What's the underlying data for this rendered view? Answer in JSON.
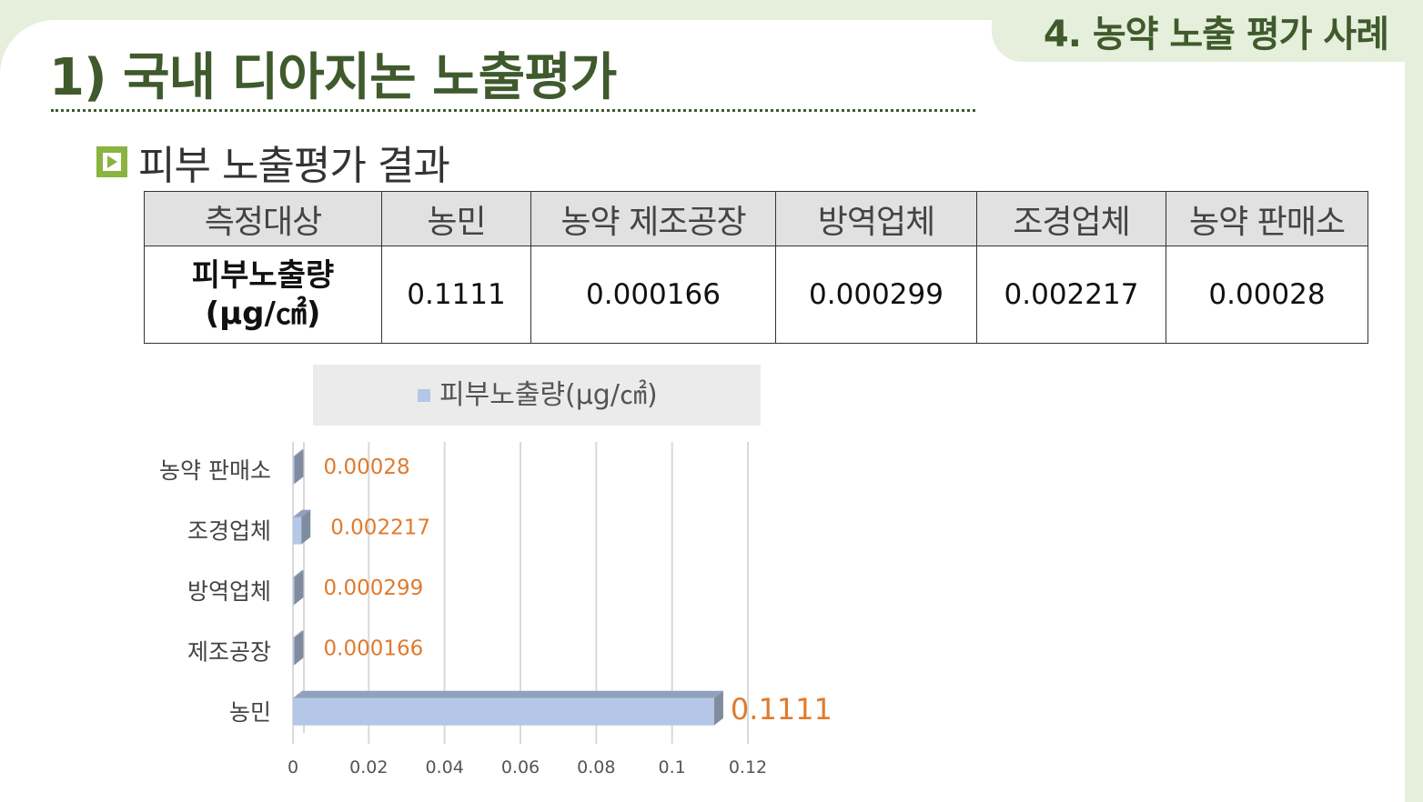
{
  "section_tab": "4. 농약 노출 평가 사례",
  "page_title": "1) 국내 디아지논 노출평가",
  "subtitle": "피부 노출평가 결과",
  "colors": {
    "accent_green": "#3f5a2c",
    "bullet_green": "#8ab33f",
    "bar_fill": "#b4c7e7",
    "bar_side": "#7f8c9f",
    "data_label": "#e07a2e",
    "legend_bg": "#ebebeb"
  },
  "table": {
    "headers": [
      "측정대상",
      "농민",
      "농약 제조공장",
      "방역업체",
      "조경업체",
      "농약 판매소"
    ],
    "row_label_line1": "피부노출량",
    "row_label_line2": "(μg/㎠)",
    "values": [
      "0.1111",
      "0.000166",
      "0.000299",
      "0.002217",
      "0.00028"
    ]
  },
  "chart_data": {
    "type": "bar",
    "orientation": "horizontal",
    "categories": [
      "농민",
      "제조공장",
      "방역업체",
      "조경업체",
      "농약 판매소"
    ],
    "series": [
      {
        "name": "피부노출량(μg/㎠)",
        "values": [
          0.1111,
          0.000166,
          0.000299,
          0.002217,
          0.00028
        ]
      }
    ],
    "data_labels": [
      "0.1111",
      "0.000166",
      "0.000299",
      "0.002217",
      "0.00028"
    ],
    "xlim": [
      0,
      0.12
    ],
    "xticks": [
      "0",
      "0.02",
      "0.04",
      "0.06",
      "0.08",
      "0.1",
      "0.12"
    ],
    "grid": "vertical",
    "legend": "top"
  }
}
